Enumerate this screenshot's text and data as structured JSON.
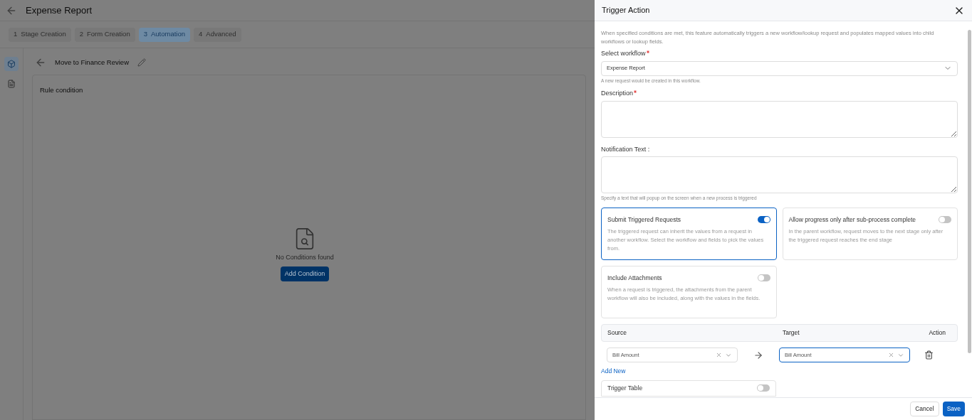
{
  "page": {
    "title": "Expense Report",
    "steps": [
      {
        "number": "1",
        "label": "Stage Creation",
        "selected": false
      },
      {
        "number": "2",
        "label": "Form Creation",
        "selected": false
      },
      {
        "number": "3",
        "label": "Automation",
        "selected": true
      },
      {
        "number": "4",
        "label": "Advanced",
        "selected": false
      }
    ],
    "side_tabs": [
      {
        "kind": "cube",
        "selected": true
      },
      {
        "kind": "form",
        "selected": false
      }
    ],
    "rule_title": "Move to Finance Review",
    "panel_title": "Rule condition",
    "empty_text": "No Conditions found",
    "add_button": "Add Condition"
  },
  "drawer": {
    "title": "Trigger Action",
    "intro": "When specified conditions are met, this feature automatically triggers a new workflow/lookup request and populates mapped values into child workflows or lookup fields.",
    "workflow": {
      "label": "Select workflow",
      "required": true,
      "value": "Expense Report",
      "hint": "A new request would be created in this workflow."
    },
    "description": {
      "label": "Description",
      "required": true
    },
    "notification": {
      "label": "Notification Text :",
      "required": false,
      "hint": "Specify a text that will popup on the screen when a new process is triggered"
    },
    "options": [
      {
        "title": "Submit Triggered Requests",
        "text": "The triggered request can inherit the values from a request in another workflow. Select the workflow and fields to pick the values from.",
        "on": true
      },
      {
        "title": "Allow progress only after sub-process complete",
        "text": "In the parent workflow, request moves to the next stage only after the triggered request reaches the end stage",
        "on": false
      },
      {
        "title": "Include Attachments",
        "text": "When a request is triggered, the attachments from the parent workflow will also be included, along with the values in the fields.",
        "on": false
      }
    ],
    "mapping": {
      "columns": [
        "Source",
        "Target",
        "Action"
      ],
      "rows": [
        {
          "source": "Bill Amount",
          "target": "Bill Amount",
          "target_focused": true
        }
      ],
      "add_new": "Add New"
    },
    "trigger_table": {
      "title": "Trigger Table",
      "on": false
    },
    "buttons": {
      "cancel": "Cancel",
      "save": "Save"
    }
  }
}
